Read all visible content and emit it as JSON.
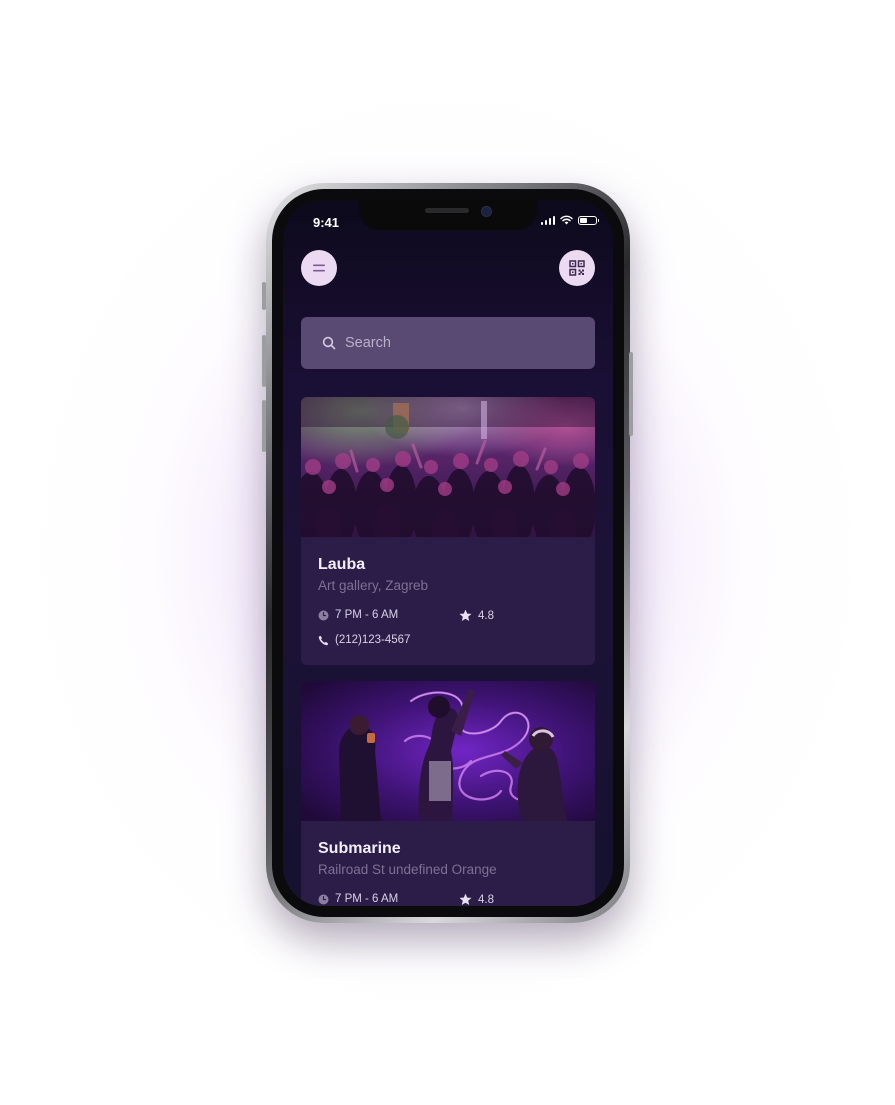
{
  "status_bar": {
    "time": "9:41"
  },
  "header": {
    "menu_icon": "menu-icon",
    "qr_icon": "qr-code-icon"
  },
  "search": {
    "placeholder": "Search",
    "icon": "search-icon"
  },
  "venues": [
    {
      "name": "Lauba",
      "subtitle": "Art gallery, Zagreb",
      "hours": "7 PM - 6 AM",
      "rating": "4.8",
      "phone": "(212)123-4567",
      "image": "crowd-party-photo"
    },
    {
      "name": "Submarine",
      "subtitle": "Railroad St undefined Orange",
      "hours": "7 PM - 6 AM",
      "rating": "4.8",
      "image": "neon-dancers-photo"
    }
  ],
  "colors": {
    "background": "#1a0f34",
    "card": "#2b1d48",
    "search_field": "#584a72",
    "button": "#ecdaf2",
    "accent_purple": "#8a3fd1"
  }
}
